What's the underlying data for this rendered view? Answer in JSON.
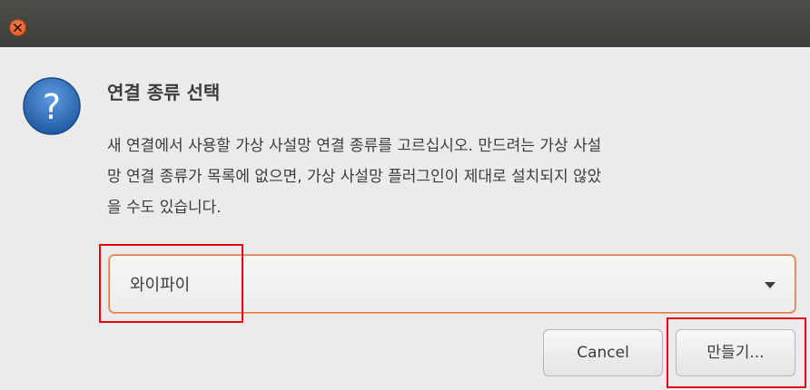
{
  "dialog": {
    "heading": "연결 종류 선택",
    "description_lines": [
      "새 연결에서 사용할 가상 사설망 연결 종류를 고르십시오. 만드려는 가상 사설",
      "망 연결 종류가 목록에 없으면, 가상 사설망 플러그인이 제대로 설치되지 않았",
      "을 수도 있습니다."
    ],
    "question_icon_glyph": "?"
  },
  "combo": {
    "selected_value": "와이파이"
  },
  "buttons": {
    "cancel_label": "Cancel",
    "create_label": "만들기..."
  },
  "colors": {
    "titlebar": "#403e3a",
    "close_button": "#e2541f",
    "focus_border": "#e07a4a",
    "annotation_box": "#e6000a",
    "question_icon": "#2f6db3"
  },
  "icons": {
    "close": "close-icon",
    "question": "question-icon",
    "dropdown": "chevron-down-icon"
  }
}
